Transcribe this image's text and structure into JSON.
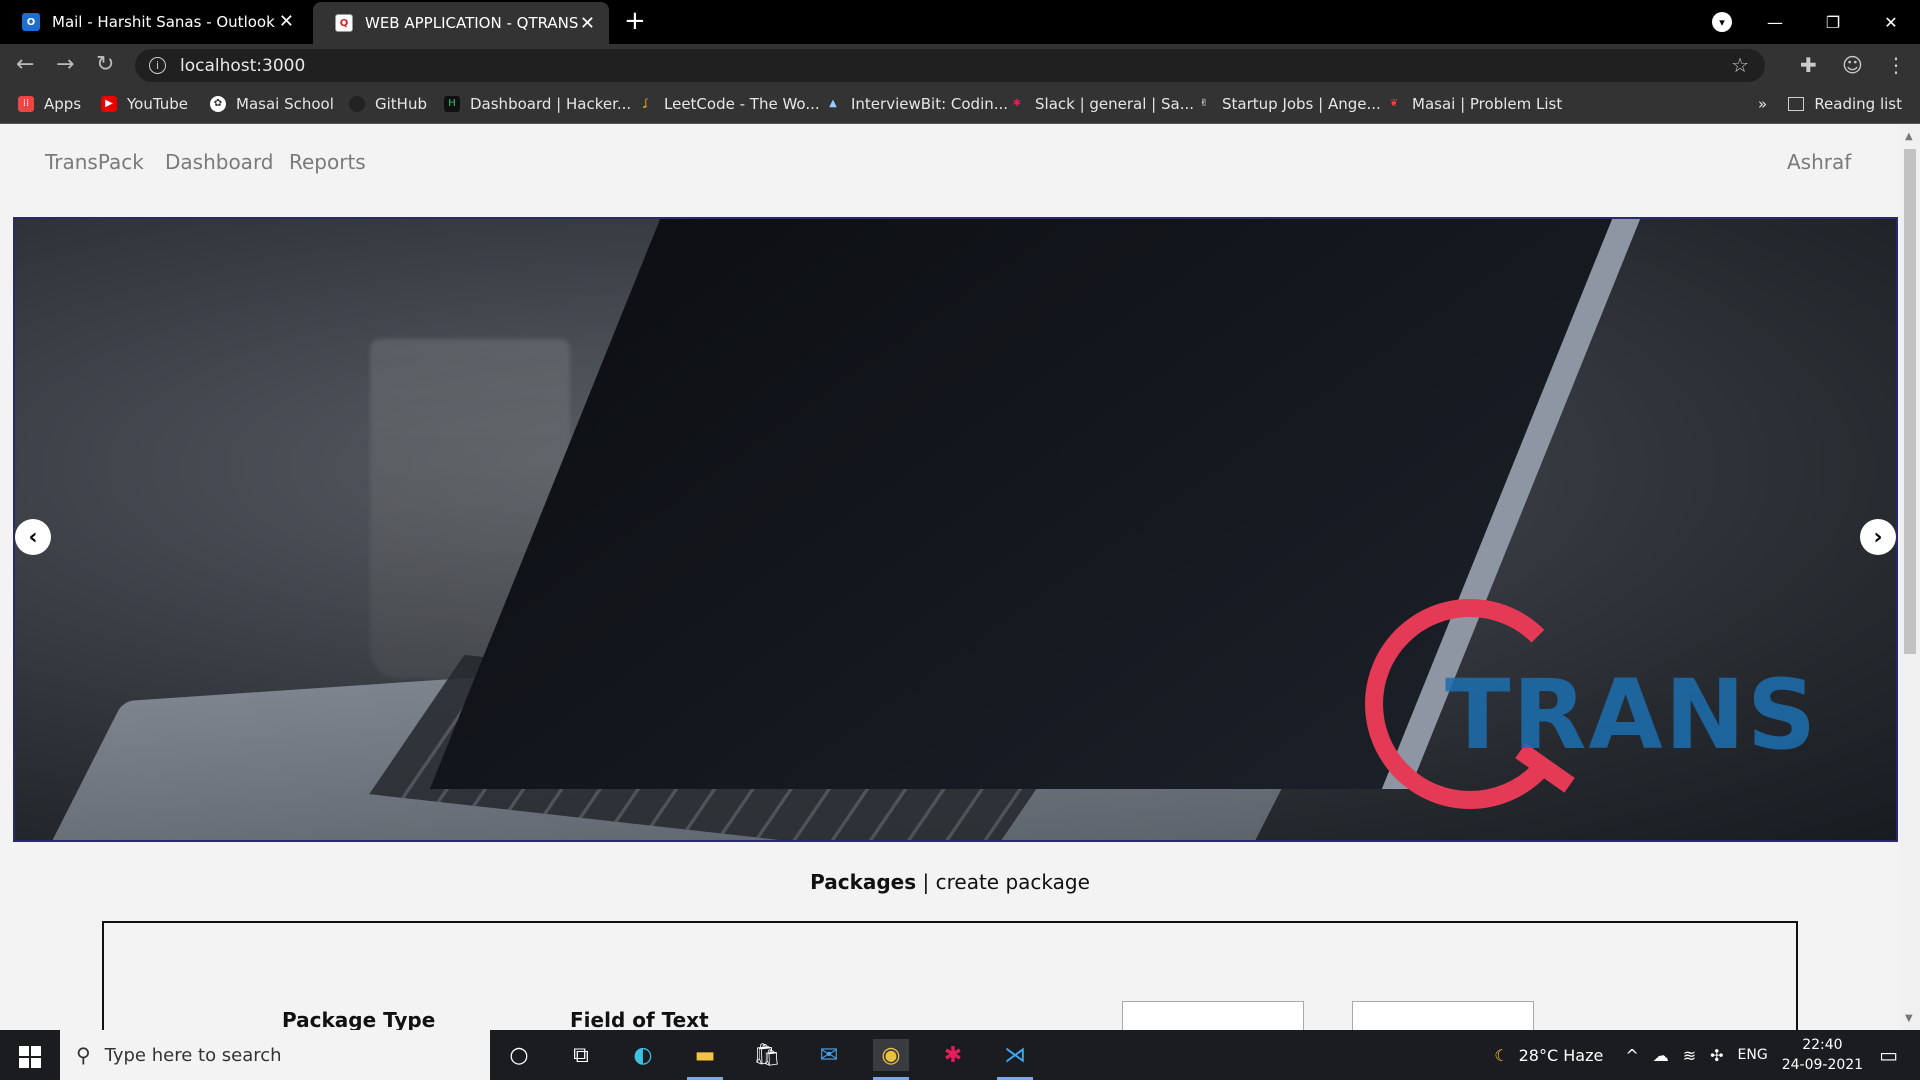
{
  "browser": {
    "tabs": [
      {
        "title": "Mail - Harshit Sanas - Outlook",
        "favicon": "outlook-icon"
      },
      {
        "title": "WEB APPLICATION - QTRANS",
        "favicon": "qtrans-icon"
      }
    ],
    "url": "localhost:3000",
    "bookmarks": [
      {
        "label": "Apps",
        "icon": "apps-grid-icon"
      },
      {
        "label": "YouTube",
        "icon": "youtube-icon"
      },
      {
        "label": "Masai School",
        "icon": "masai-icon"
      },
      {
        "label": "GitHub",
        "icon": "github-icon"
      },
      {
        "label": "Dashboard | Hacker...",
        "icon": "hackerrank-icon"
      },
      {
        "label": "LeetCode - The Wo...",
        "icon": "leetcode-icon"
      },
      {
        "label": "InterviewBit: Codin...",
        "icon": "interviewbit-icon"
      },
      {
        "label": "Slack | general | Sa...",
        "icon": "slack-icon"
      },
      {
        "label": "Startup Jobs | Ange...",
        "icon": "angellist-icon"
      },
      {
        "label": "Masai | Problem List",
        "icon": "masai-problem-icon"
      }
    ],
    "overflow": "»",
    "reading_list": "Reading list"
  },
  "app": {
    "nav": {
      "brand": "TransPack",
      "dashboard": "Dashboard",
      "reports": "Reports",
      "user": "Ashraf"
    },
    "carousel": {
      "logo_text": "TRANS",
      "prev": "‹",
      "next": "›"
    },
    "package_links": {
      "packages": "Packages",
      "separator": "|",
      "create": "create package"
    },
    "form": {
      "package_type_label": "Package Type",
      "field_of_text_label": "Field of Text"
    }
  },
  "taskbar": {
    "search_placeholder": "Type here to search",
    "weather": "28°C  Haze",
    "language": "ENG",
    "time": "22:40",
    "date": "24-09-2021"
  },
  "colors": {
    "accent_red": "#e43a55",
    "logo_blue": "#1d6fb0",
    "chrome_dark": "#333333"
  }
}
